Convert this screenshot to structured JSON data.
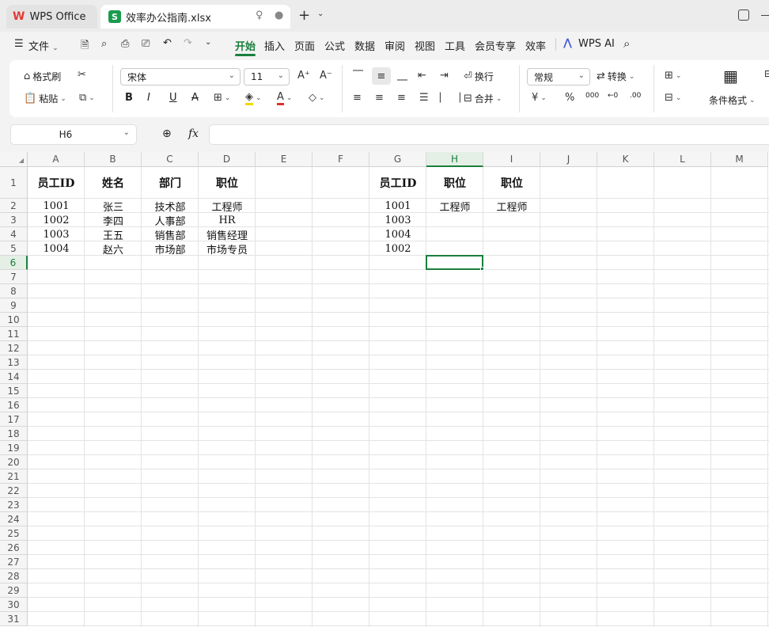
{
  "titlebar": {
    "app_tab": "WPS Office",
    "file_tab": "效率办公指南.xlsx"
  },
  "menubar": {
    "file": "文件",
    "items": [
      "开始",
      "插入",
      "页面",
      "公式",
      "数据",
      "审阅",
      "视图",
      "工具",
      "会员专享",
      "效率"
    ],
    "ai": "WPS AI"
  },
  "ribbon": {
    "format_painter": "格式刷",
    "paste": "粘贴",
    "font_name": "宋体",
    "font_size": "11",
    "wrap": "换行",
    "number_format": "常规",
    "convert": "转换",
    "merge": "合并",
    "conditional_format": "条件格式"
  },
  "formula": {
    "name_box": "H6",
    "fx": "fx",
    "value": ""
  },
  "grid": {
    "columns": [
      "A",
      "B",
      "C",
      "D",
      "E",
      "F",
      "G",
      "H",
      "I",
      "J",
      "K",
      "L",
      "M"
    ],
    "rows": [
      "1",
      "2",
      "3",
      "4",
      "5",
      "6",
      "7",
      "8",
      "9",
      "10",
      "11",
      "12",
      "13",
      "14",
      "15",
      "16",
      "17",
      "18",
      "19",
      "20",
      "21",
      "22",
      "23",
      "24",
      "25",
      "26",
      "27",
      "28",
      "29",
      "30",
      "31"
    ],
    "selected_cell": "H6",
    "cells": {
      "A1": "员工ID",
      "B1": "姓名",
      "C1": "部门",
      "D1": "职位",
      "A2": "1001",
      "B2": "张三",
      "C2": "技术部",
      "D2": "工程师",
      "A3": "1002",
      "B3": "李四",
      "C3": "人事部",
      "D3": "HR",
      "A4": "1003",
      "B4": "王五",
      "C4": "销售部",
      "D4": "销售经理",
      "A5": "1004",
      "B5": "赵六",
      "C5": "市场部",
      "D5": "市场专员",
      "G1": "员工ID",
      "H1": "职位",
      "I1": "职位",
      "G2": "1001",
      "H2": "工程师",
      "I2": "工程师",
      "G3": "1003",
      "G4": "1004",
      "G5": "1002"
    }
  }
}
